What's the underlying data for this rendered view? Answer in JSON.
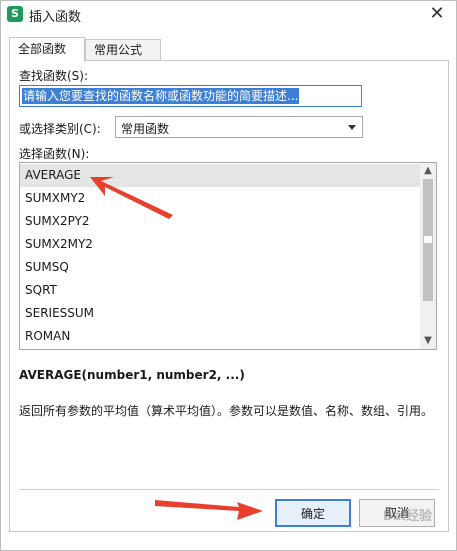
{
  "window": {
    "title": "插入函数",
    "app_icon_glyph": "S",
    "close_glyph": "✕"
  },
  "tabs": [
    {
      "label": "全部函数",
      "active": true
    },
    {
      "label": "常用公式",
      "active": false
    }
  ],
  "search": {
    "label": "查找函数(S):",
    "value": "请输入您要查找的函数名称或函数功能的简要描述..."
  },
  "category": {
    "label": "或选择类别(C):",
    "selected": "常用函数"
  },
  "function_list": {
    "label": "选择函数(N):",
    "items": [
      "AVERAGE",
      "SUMXMY2",
      "SUMX2PY2",
      "SUMX2MY2",
      "SUMSQ",
      "SQRT",
      "SERIESSUM",
      "ROMAN"
    ],
    "selected_index": 0
  },
  "details": {
    "signature": "AVERAGE(number1, number2, ...)",
    "description": "返回所有参数的平均值（算术平均值）。参数可以是数值、名称、数组、引用。"
  },
  "buttons": {
    "ok": "确定",
    "cancel": "取消"
  },
  "watermark": "Bai经验",
  "colors": {
    "accent": "#3c7fd6",
    "annotation_arrow": "#e8402c",
    "app_icon": "#1e9b5a"
  }
}
